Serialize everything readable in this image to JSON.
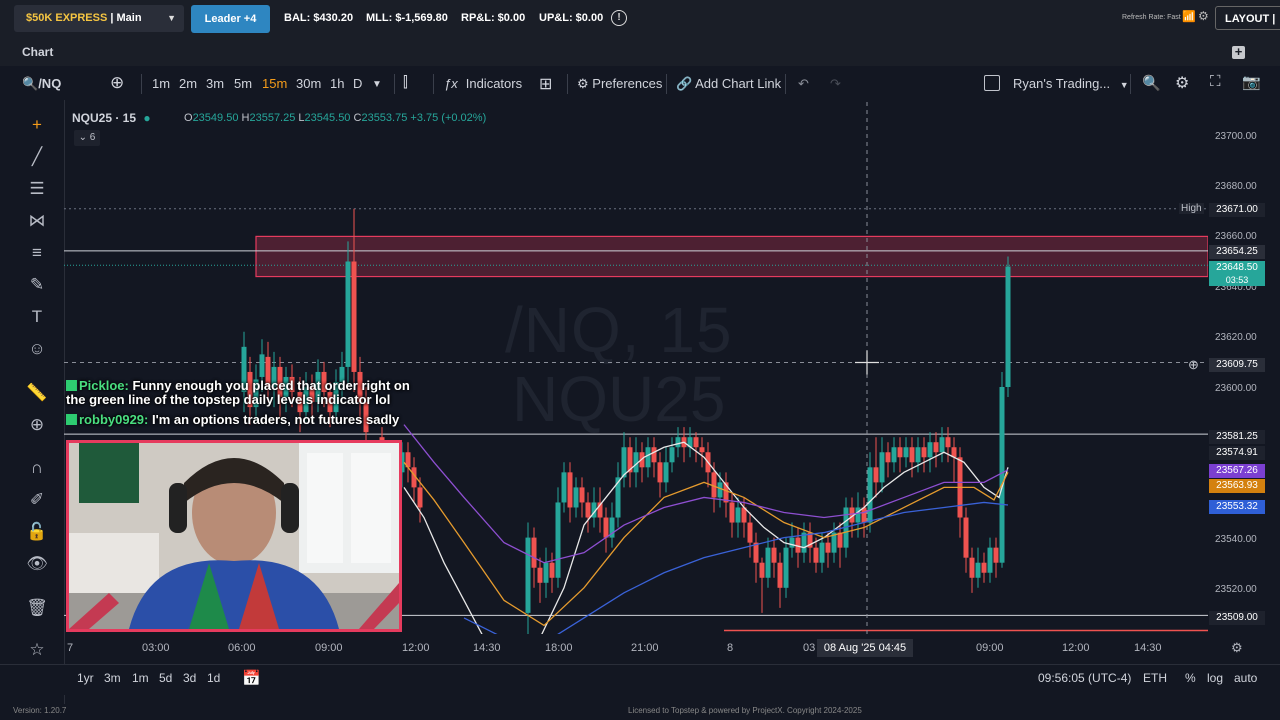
{
  "topbar": {
    "account_prefix": "$50K EXPRESS",
    "account_rest": " | Main Accou...",
    "leader_label": "Leader +4",
    "stats": [
      "BAL: $430.20",
      "MLL: $-1,569.80",
      "RP&L: $0.00",
      "UP&L: $0.00"
    ],
    "refresh_rate": "Refresh Rate: Fast",
    "layout_label": "LAYOUT | de"
  },
  "chart_tab": "Chart",
  "toolbar": {
    "symbol": "/NQ",
    "timeframes": [
      "1m",
      "2m",
      "3m",
      "5m",
      "15m",
      "30m",
      "1h",
      "D"
    ],
    "active_timeframe": "15m",
    "indicators": "Indicators",
    "preferences": "Preferences",
    "add_chart_link": "Add Chart Link",
    "template": "Ryan's Trading..."
  },
  "legend": {
    "symbol": "NQU25 · 15",
    "o_label": "O",
    "o": "23549.50",
    "h_label": "H",
    "h": "23557.25",
    "l_label": "L",
    "l": "23545.50",
    "c_label": "C",
    "c": "23553.75",
    "change": "+3.75 (+0.02%)",
    "collapse": "6"
  },
  "watermark": {
    "line1": "/NQ, 15",
    "line2": "NQU25"
  },
  "chat": [
    {
      "name": "Pickloe:",
      "text": "Funny enough you placed that order right on",
      "text2": "the green line of the topstep daily levels indicator lol"
    },
    {
      "name": "robby0929:",
      "text": "I'm an options traders, not futures sadly"
    }
  ],
  "price_axis": {
    "labels": [
      "23700.00",
      "23680.00",
      "23640.00",
      "23620.00",
      "23600.00",
      "23540.00",
      "23520.00"
    ],
    "high_tag": "High",
    "boxes": [
      {
        "text": "23671.00",
        "color": "#131722"
      },
      {
        "text": "23654.25",
        "color": "#131722"
      },
      {
        "text": "23648.50",
        "color": "#26a69a"
      },
      {
        "text": "03:53",
        "color": "#26a69a"
      },
      {
        "text": "23609.75",
        "color": "#131722"
      },
      {
        "text": "23581.25",
        "color": "#131722"
      },
      {
        "text": "23574.91",
        "color": "#131722"
      },
      {
        "text": "23567.26",
        "color": "#7b3fd1"
      },
      {
        "text": "23563.93",
        "color": "#d4810f"
      },
      {
        "text": "23553.32",
        "color": "#2f5fd6"
      },
      {
        "text": "23509.00",
        "color": "#131722"
      }
    ],
    "partial": "23660.00"
  },
  "time_axis": {
    "labels": [
      "7",
      "03:00",
      "06:00",
      "09:00",
      "12:00",
      "14:30",
      "18:00",
      "21:00",
      "8",
      "03",
      "09:00",
      "12:00",
      "14:30"
    ],
    "crosshair": "08 Aug '25   04:45"
  },
  "bottombar": {
    "ranges": [
      "1yr",
      "3m",
      "1m",
      "5d",
      "3d",
      "1d"
    ],
    "clock": "09:56:05 (UTC-4)",
    "session": "ETH",
    "pct": "%",
    "log": "log",
    "auto": "auto"
  },
  "footer": {
    "version": "Version: 1.20.7",
    "license": "Licensed to Topstep & powered by ProjectX. Copyright 2024-2025"
  },
  "colors": {
    "up": "#26a69a",
    "down": "#ef5350",
    "resistance_zone": "#e63b5e",
    "ema_white": "#e8e8e8",
    "ema_orange": "#e59b2e",
    "ema_purple": "#8e4fd1",
    "ema_blue": "#3a62d8"
  }
}
